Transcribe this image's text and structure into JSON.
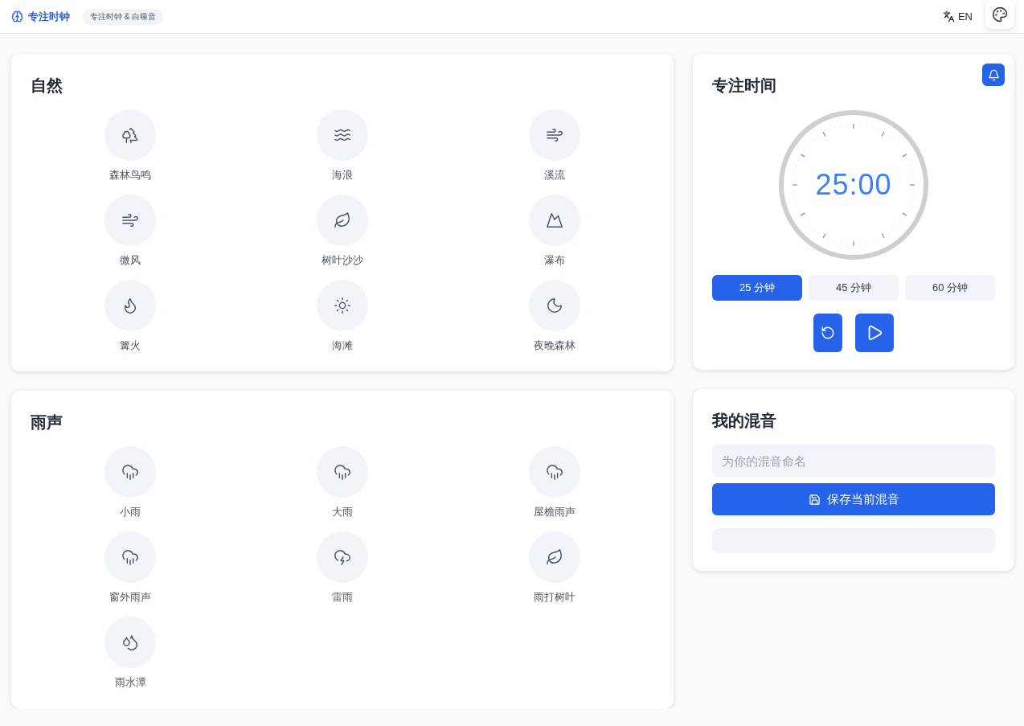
{
  "header": {
    "brand": "专注时钟",
    "tagline": "专注时钟 & 白噪音",
    "language": "EN"
  },
  "categories": [
    {
      "title": "自然",
      "sounds": [
        {
          "label": "森林鸟鸣",
          "kind": "trees"
        },
        {
          "label": "海浪",
          "kind": "waves"
        },
        {
          "label": "溪流",
          "kind": "wind"
        },
        {
          "label": "微风",
          "kind": "wind"
        },
        {
          "label": "树叶沙沙",
          "kind": "leaf"
        },
        {
          "label": "瀑布",
          "kind": "mountain"
        },
        {
          "label": "篝火",
          "kind": "flame"
        },
        {
          "label": "海滩",
          "kind": "sun"
        },
        {
          "label": "夜晚森林",
          "kind": "moon"
        }
      ]
    },
    {
      "title": "雨声",
      "sounds": [
        {
          "label": "小雨",
          "kind": "rain"
        },
        {
          "label": "大雨",
          "kind": "rain"
        },
        {
          "label": "屋檐雨声",
          "kind": "rain"
        },
        {
          "label": "窗外雨声",
          "kind": "rain"
        },
        {
          "label": "雷雨",
          "kind": "storm"
        },
        {
          "label": "雨打树叶",
          "kind": "leaf"
        },
        {
          "label": "雨水潭",
          "kind": "droplets"
        }
      ]
    }
  ],
  "timer": {
    "title": "专注时间",
    "time": "25:00",
    "presets": [
      {
        "label": "25 分钟",
        "selected": true
      },
      {
        "label": "45 分钟",
        "selected": false
      },
      {
        "label": "60 分钟",
        "selected": false
      }
    ]
  },
  "mix": {
    "title": "我的混音",
    "placeholder": "为你的混音命名",
    "save_label": "保存当前混音"
  }
}
